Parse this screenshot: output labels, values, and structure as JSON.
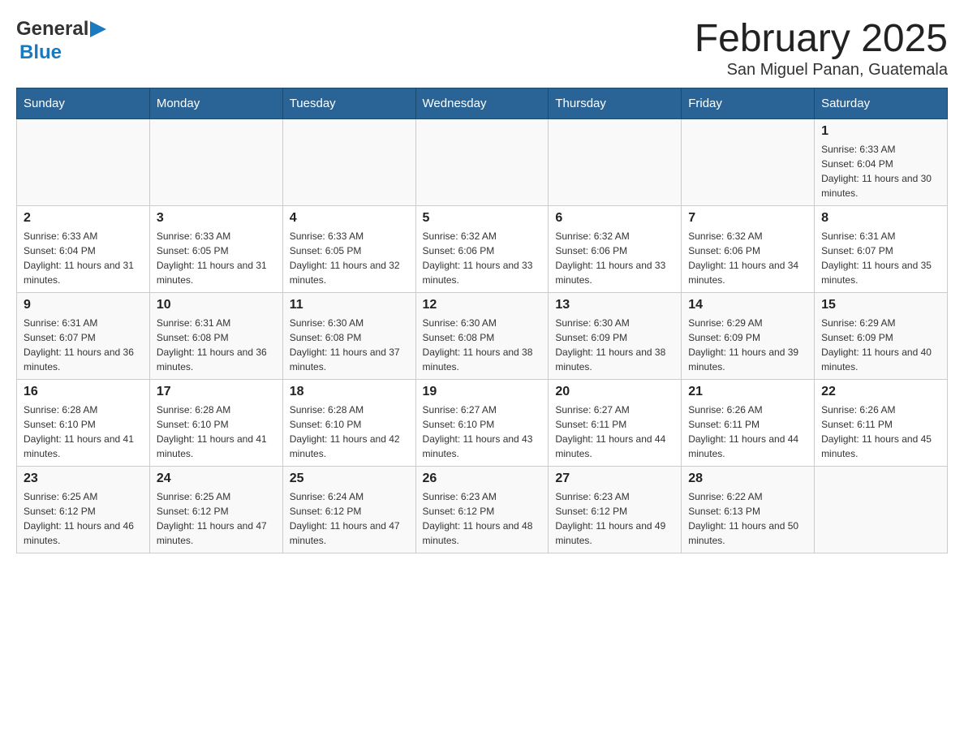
{
  "header": {
    "logo_general": "General",
    "logo_blue": "Blue",
    "title": "February 2025",
    "subtitle": "San Miguel Panan, Guatemala"
  },
  "days_of_week": [
    "Sunday",
    "Monday",
    "Tuesday",
    "Wednesday",
    "Thursday",
    "Friday",
    "Saturday"
  ],
  "weeks": [
    [
      {
        "day": "",
        "sunrise": "",
        "sunset": "",
        "daylight": ""
      },
      {
        "day": "",
        "sunrise": "",
        "sunset": "",
        "daylight": ""
      },
      {
        "day": "",
        "sunrise": "",
        "sunset": "",
        "daylight": ""
      },
      {
        "day": "",
        "sunrise": "",
        "sunset": "",
        "daylight": ""
      },
      {
        "day": "",
        "sunrise": "",
        "sunset": "",
        "daylight": ""
      },
      {
        "day": "",
        "sunrise": "",
        "sunset": "",
        "daylight": ""
      },
      {
        "day": "1",
        "sunrise": "Sunrise: 6:33 AM",
        "sunset": "Sunset: 6:04 PM",
        "daylight": "Daylight: 11 hours and 30 minutes."
      }
    ],
    [
      {
        "day": "2",
        "sunrise": "Sunrise: 6:33 AM",
        "sunset": "Sunset: 6:04 PM",
        "daylight": "Daylight: 11 hours and 31 minutes."
      },
      {
        "day": "3",
        "sunrise": "Sunrise: 6:33 AM",
        "sunset": "Sunset: 6:05 PM",
        "daylight": "Daylight: 11 hours and 31 minutes."
      },
      {
        "day": "4",
        "sunrise": "Sunrise: 6:33 AM",
        "sunset": "Sunset: 6:05 PM",
        "daylight": "Daylight: 11 hours and 32 minutes."
      },
      {
        "day": "5",
        "sunrise": "Sunrise: 6:32 AM",
        "sunset": "Sunset: 6:06 PM",
        "daylight": "Daylight: 11 hours and 33 minutes."
      },
      {
        "day": "6",
        "sunrise": "Sunrise: 6:32 AM",
        "sunset": "Sunset: 6:06 PM",
        "daylight": "Daylight: 11 hours and 33 minutes."
      },
      {
        "day": "7",
        "sunrise": "Sunrise: 6:32 AM",
        "sunset": "Sunset: 6:06 PM",
        "daylight": "Daylight: 11 hours and 34 minutes."
      },
      {
        "day": "8",
        "sunrise": "Sunrise: 6:31 AM",
        "sunset": "Sunset: 6:07 PM",
        "daylight": "Daylight: 11 hours and 35 minutes."
      }
    ],
    [
      {
        "day": "9",
        "sunrise": "Sunrise: 6:31 AM",
        "sunset": "Sunset: 6:07 PM",
        "daylight": "Daylight: 11 hours and 36 minutes."
      },
      {
        "day": "10",
        "sunrise": "Sunrise: 6:31 AM",
        "sunset": "Sunset: 6:08 PM",
        "daylight": "Daylight: 11 hours and 36 minutes."
      },
      {
        "day": "11",
        "sunrise": "Sunrise: 6:30 AM",
        "sunset": "Sunset: 6:08 PM",
        "daylight": "Daylight: 11 hours and 37 minutes."
      },
      {
        "day": "12",
        "sunrise": "Sunrise: 6:30 AM",
        "sunset": "Sunset: 6:08 PM",
        "daylight": "Daylight: 11 hours and 38 minutes."
      },
      {
        "day": "13",
        "sunrise": "Sunrise: 6:30 AM",
        "sunset": "Sunset: 6:09 PM",
        "daylight": "Daylight: 11 hours and 38 minutes."
      },
      {
        "day": "14",
        "sunrise": "Sunrise: 6:29 AM",
        "sunset": "Sunset: 6:09 PM",
        "daylight": "Daylight: 11 hours and 39 minutes."
      },
      {
        "day": "15",
        "sunrise": "Sunrise: 6:29 AM",
        "sunset": "Sunset: 6:09 PM",
        "daylight": "Daylight: 11 hours and 40 minutes."
      }
    ],
    [
      {
        "day": "16",
        "sunrise": "Sunrise: 6:28 AM",
        "sunset": "Sunset: 6:10 PM",
        "daylight": "Daylight: 11 hours and 41 minutes."
      },
      {
        "day": "17",
        "sunrise": "Sunrise: 6:28 AM",
        "sunset": "Sunset: 6:10 PM",
        "daylight": "Daylight: 11 hours and 41 minutes."
      },
      {
        "day": "18",
        "sunrise": "Sunrise: 6:28 AM",
        "sunset": "Sunset: 6:10 PM",
        "daylight": "Daylight: 11 hours and 42 minutes."
      },
      {
        "day": "19",
        "sunrise": "Sunrise: 6:27 AM",
        "sunset": "Sunset: 6:10 PM",
        "daylight": "Daylight: 11 hours and 43 minutes."
      },
      {
        "day": "20",
        "sunrise": "Sunrise: 6:27 AM",
        "sunset": "Sunset: 6:11 PM",
        "daylight": "Daylight: 11 hours and 44 minutes."
      },
      {
        "day": "21",
        "sunrise": "Sunrise: 6:26 AM",
        "sunset": "Sunset: 6:11 PM",
        "daylight": "Daylight: 11 hours and 44 minutes."
      },
      {
        "day": "22",
        "sunrise": "Sunrise: 6:26 AM",
        "sunset": "Sunset: 6:11 PM",
        "daylight": "Daylight: 11 hours and 45 minutes."
      }
    ],
    [
      {
        "day": "23",
        "sunrise": "Sunrise: 6:25 AM",
        "sunset": "Sunset: 6:12 PM",
        "daylight": "Daylight: 11 hours and 46 minutes."
      },
      {
        "day": "24",
        "sunrise": "Sunrise: 6:25 AM",
        "sunset": "Sunset: 6:12 PM",
        "daylight": "Daylight: 11 hours and 47 minutes."
      },
      {
        "day": "25",
        "sunrise": "Sunrise: 6:24 AM",
        "sunset": "Sunset: 6:12 PM",
        "daylight": "Daylight: 11 hours and 47 minutes."
      },
      {
        "day": "26",
        "sunrise": "Sunrise: 6:23 AM",
        "sunset": "Sunset: 6:12 PM",
        "daylight": "Daylight: 11 hours and 48 minutes."
      },
      {
        "day": "27",
        "sunrise": "Sunrise: 6:23 AM",
        "sunset": "Sunset: 6:12 PM",
        "daylight": "Daylight: 11 hours and 49 minutes."
      },
      {
        "day": "28",
        "sunrise": "Sunrise: 6:22 AM",
        "sunset": "Sunset: 6:13 PM",
        "daylight": "Daylight: 11 hours and 50 minutes."
      },
      {
        "day": "",
        "sunrise": "",
        "sunset": "",
        "daylight": ""
      }
    ]
  ]
}
